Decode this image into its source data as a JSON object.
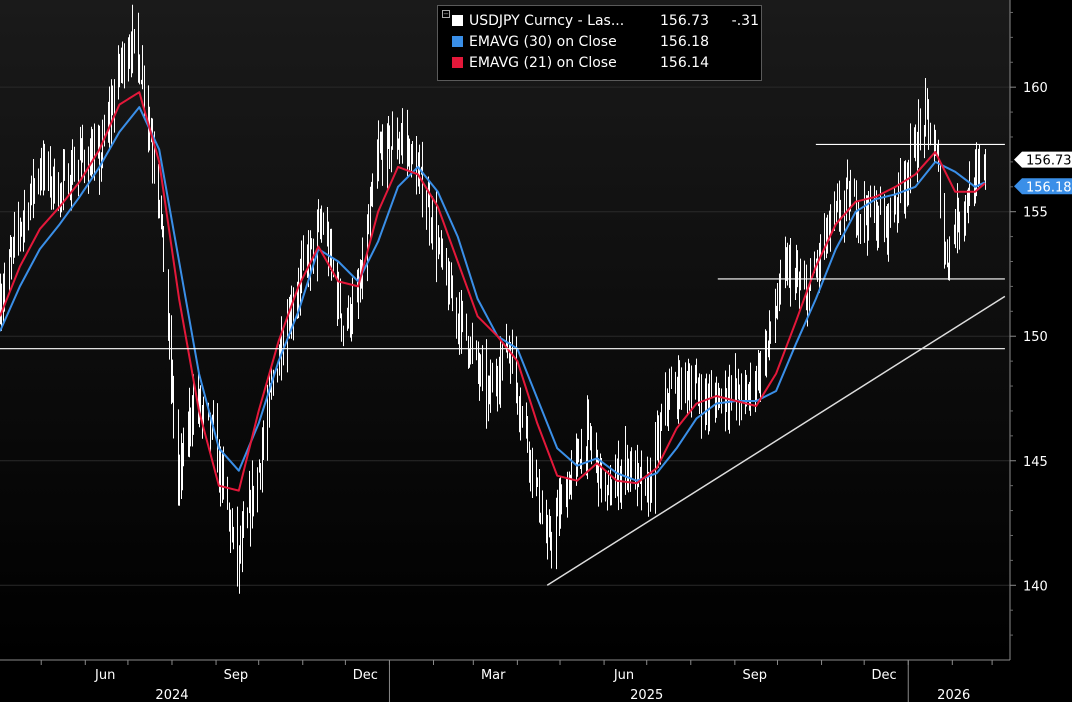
{
  "colors": {
    "background": "#000000",
    "price_bars": "#ffffff",
    "ema30": "#3a8fe8",
    "ema21": "#e4183a",
    "reference_lines": "#ffffff",
    "grid": "#2a2a2a",
    "axis_text": "#ffffff"
  },
  "legend": {
    "rows": [
      {
        "name": "USDJPY Curncy - Las...",
        "value": "156.73",
        "change": "-.31",
        "color": "#ffffff"
      },
      {
        "name": "EMAVG (30) on Close",
        "value": "156.18",
        "change": "",
        "color": "#3a8fe8"
      },
      {
        "name": "EMAVG (21) on Close",
        "value": "156.14",
        "change": "",
        "color": "#e4183a"
      }
    ]
  },
  "chart_data": {
    "type": "line",
    "title": "",
    "xlabel": "",
    "ylabel": "",
    "ylim": [
      137,
      163.5
    ],
    "y_ticks": [
      140,
      145,
      150,
      155,
      160
    ],
    "x_tick_labels": [
      "Jun",
      "Sep",
      "Dec",
      "Mar",
      "Jun",
      "Sep",
      "Dec"
    ],
    "x_year_labels": [
      "2024",
      "2025",
      "2026"
    ],
    "x_range": [
      "2024-04-02",
      "2026-02-24"
    ],
    "price_tags": [
      {
        "label": "156.73",
        "value": 156.73,
        "series": "USDJPY Curncy - Las..."
      },
      {
        "label": "156.18",
        "value": 156.18,
        "series": "EMAVG (30) on Close"
      }
    ],
    "series": [
      {
        "name": "USDJPY Curncy - Las...",
        "style": "daily-bars",
        "x": [
          "2024-04-02",
          "2024-04-16",
          "2024-04-30",
          "2024-05-14",
          "2024-05-28",
          "2024-06-11",
          "2024-06-25",
          "2024-07-03",
          "2024-07-11",
          "2024-07-23",
          "2024-08-05",
          "2024-08-16",
          "2024-08-30",
          "2024-09-16",
          "2024-09-30",
          "2024-10-15",
          "2024-10-31",
          "2024-11-15",
          "2024-11-29",
          "2024-12-10",
          "2024-12-24",
          "2025-01-10",
          "2025-01-27",
          "2025-02-10",
          "2025-02-24",
          "2025-03-11",
          "2025-03-25",
          "2025-04-08",
          "2025-04-22",
          "2025-05-06",
          "2025-05-20",
          "2025-06-03",
          "2025-06-17",
          "2025-07-01",
          "2025-07-15",
          "2025-07-29",
          "2025-08-12",
          "2025-08-26",
          "2025-09-09",
          "2025-09-23",
          "2025-10-07",
          "2025-10-21",
          "2025-11-04",
          "2025-11-18",
          "2025-12-02",
          "2025-12-16",
          "2025-12-30",
          "2026-01-13",
          "2026-01-21",
          "2026-01-27",
          "2026-02-03",
          "2026-02-10",
          "2026-02-24"
        ],
        "y": [
          151.5,
          154.5,
          156.8,
          155.8,
          157.2,
          157.0,
          160.8,
          161.9,
          160.5,
          155.5,
          144.0,
          147.5,
          146.0,
          140.8,
          144.5,
          149.5,
          152.5,
          154.5,
          150.5,
          151.5,
          157.3,
          158.0,
          155.5,
          152.0,
          150.0,
          147.5,
          149.8,
          145.8,
          141.5,
          144.0,
          146.0,
          143.5,
          145.0,
          143.5,
          147.5,
          148.2,
          147.3,
          147.8,
          147.5,
          149.5,
          152.8,
          151.5,
          154.0,
          155.5,
          155.0,
          154.5,
          156.5,
          158.8,
          157.0,
          153.0,
          154.6,
          155.5,
          156.73
        ]
      },
      {
        "name": "EMAVG (30) on Close",
        "x": [
          "2024-04-02",
          "2024-04-16",
          "2024-04-30",
          "2024-05-14",
          "2024-05-28",
          "2024-06-11",
          "2024-06-25",
          "2024-07-09",
          "2024-07-23",
          "2024-08-06",
          "2024-08-20",
          "2024-09-03",
          "2024-09-17",
          "2024-10-01",
          "2024-10-15",
          "2024-10-29",
          "2024-11-12",
          "2024-11-26",
          "2024-12-10",
          "2024-12-24",
          "2025-01-07",
          "2025-01-21",
          "2025-02-04",
          "2025-02-18",
          "2025-03-04",
          "2025-03-18",
          "2025-04-01",
          "2025-04-15",
          "2025-04-29",
          "2025-05-13",
          "2025-05-27",
          "2025-06-10",
          "2025-06-24",
          "2025-07-08",
          "2025-07-22",
          "2025-08-05",
          "2025-08-19",
          "2025-09-02",
          "2025-09-16",
          "2025-09-30",
          "2025-10-14",
          "2025-10-28",
          "2025-11-11",
          "2025-11-25",
          "2025-12-09",
          "2025-12-23",
          "2026-01-06",
          "2026-01-20",
          "2026-02-03",
          "2026-02-17",
          "2026-02-24"
        ],
        "y": [
          150.2,
          152.0,
          153.5,
          154.5,
          155.6,
          156.8,
          158.2,
          159.2,
          157.5,
          153.0,
          148.5,
          145.5,
          144.6,
          146.5,
          149.0,
          151.0,
          153.5,
          153.0,
          152.2,
          153.8,
          156.0,
          156.8,
          155.8,
          154.0,
          151.5,
          150.0,
          149.5,
          147.5,
          145.5,
          144.8,
          145.1,
          144.5,
          144.2,
          144.5,
          145.5,
          146.7,
          147.3,
          147.4,
          147.4,
          147.8,
          149.7,
          151.5,
          153.5,
          155.0,
          155.5,
          155.7,
          156.0,
          157.0,
          156.6,
          156.0,
          156.18
        ]
      },
      {
        "name": "EMAVG (21) on Close",
        "x": [
          "2024-04-02",
          "2024-04-16",
          "2024-04-30",
          "2024-05-14",
          "2024-05-28",
          "2024-06-11",
          "2024-06-25",
          "2024-07-09",
          "2024-07-23",
          "2024-08-06",
          "2024-08-20",
          "2024-09-03",
          "2024-09-17",
          "2024-10-01",
          "2024-10-15",
          "2024-10-29",
          "2024-11-12",
          "2024-11-26",
          "2024-12-10",
          "2024-12-24",
          "2025-01-07",
          "2025-01-21",
          "2025-02-04",
          "2025-02-18",
          "2025-03-04",
          "2025-03-18",
          "2025-04-01",
          "2025-04-15",
          "2025-04-29",
          "2025-05-13",
          "2025-05-27",
          "2025-06-10",
          "2025-06-24",
          "2025-07-08",
          "2025-07-22",
          "2025-08-05",
          "2025-08-19",
          "2025-09-02",
          "2025-09-16",
          "2025-09-30",
          "2025-10-14",
          "2025-10-28",
          "2025-11-11",
          "2025-11-25",
          "2025-12-09",
          "2025-12-23",
          "2026-01-06",
          "2026-01-20",
          "2026-02-03",
          "2026-02-17",
          "2026-02-24"
        ],
        "y": [
          150.8,
          152.8,
          154.3,
          155.2,
          156.2,
          157.5,
          159.3,
          159.8,
          157.0,
          151.5,
          147.0,
          144.0,
          143.8,
          147.0,
          149.8,
          152.0,
          153.6,
          152.2,
          152.0,
          155.0,
          156.8,
          156.5,
          155.2,
          153.0,
          150.8,
          150.0,
          149.0,
          146.5,
          144.4,
          144.2,
          144.9,
          144.2,
          144.1,
          144.7,
          146.3,
          147.3,
          147.6,
          147.4,
          147.2,
          148.5,
          150.6,
          152.8,
          154.5,
          155.4,
          155.6,
          156.0,
          156.5,
          157.4,
          155.8,
          155.8,
          156.14
        ]
      }
    ],
    "reference_lines": [
      {
        "type": "horizontal",
        "value": 149.5,
        "x_from": "2024-04-02",
        "x_to": "2026-03-10"
      },
      {
        "type": "horizontal",
        "value": 157.7,
        "x_from": "2025-10-28",
        "x_to": "2026-03-10"
      },
      {
        "type": "horizontal",
        "value": 152.3,
        "x_from": "2025-08-20",
        "x_to": "2026-03-10"
      },
      {
        "type": "trend",
        "from": {
          "x": "2025-04-22",
          "y": 140.0
        },
        "to": {
          "x": "2026-03-10",
          "y": 151.6
        }
      }
    ]
  }
}
